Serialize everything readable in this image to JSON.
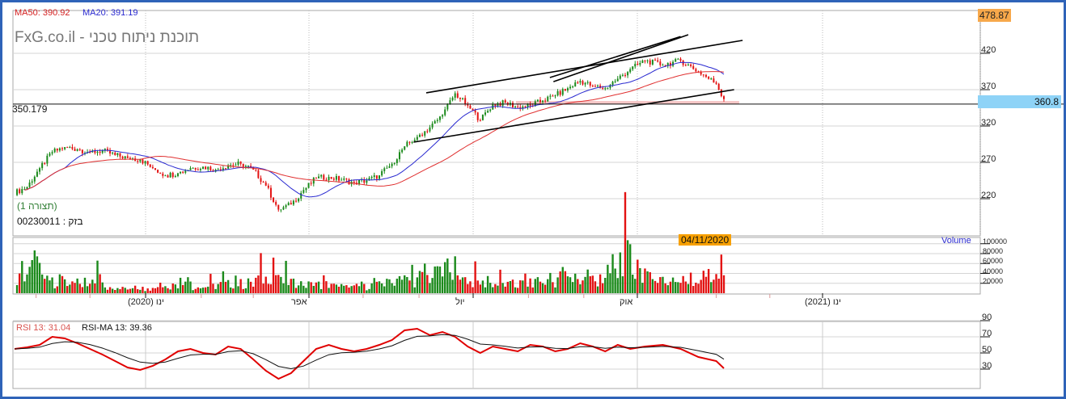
{
  "header": {
    "ma50_label": "MA50: 390.92",
    "ma20_label": "MA20: 391.19",
    "title": "תוכנת ניתוח טכני - FxG.co.il",
    "view_label": "(תצורה 1)",
    "symbol_label": "בזק : 00230011",
    "hline_label": "350.179",
    "top_price_badge": "478.87",
    "cursor_price_badge": "360.8",
    "date_badge": "04/11/2020",
    "volume_label": "Volume",
    "rsi_label": "RSI 13: 31.04",
    "rsi_ma_label": "RSI-MA 13: 39.36"
  },
  "colors": {
    "up": "#1b8a1b",
    "down": "#e31212",
    "ma20": "#2a2ad0",
    "ma50": "#e03030",
    "rsi": "#e00000",
    "rsi_ma": "#111111",
    "badge_orange": "#f7a84a",
    "badge_blue": "#8ed3f7",
    "frame": "#2f63b8"
  },
  "chart_data": [
    {
      "type": "candlestick",
      "panel": "price",
      "yticks": [
        420,
        370,
        320,
        270,
        220
      ],
      "ylim": [
        180,
        478.87
      ],
      "xticks": [
        {
          "date": "2020-01-01",
          "label": "ינו (2020)"
        },
        {
          "date": "2020-04-01",
          "label": "אפר"
        },
        {
          "date": "2020-07-01",
          "label": "יול"
        },
        {
          "date": "2020-10-01",
          "label": "אוק"
        },
        {
          "date": "2021-01-01",
          "label": "ינו (2021)"
        }
      ],
      "dates": [
        "2019-10-20",
        "2019-10-27",
        "2019-11-03",
        "2019-11-10",
        "2019-11-17",
        "2019-11-24",
        "2019-12-01",
        "2019-12-08",
        "2019-12-15",
        "2019-12-22",
        "2019-12-29",
        "2020-01-05",
        "2020-01-12",
        "2020-01-19",
        "2020-01-26",
        "2020-02-02",
        "2020-02-09",
        "2020-02-16",
        "2020-02-23",
        "2020-03-01",
        "2020-03-08",
        "2020-03-15",
        "2020-03-22",
        "2020-03-29",
        "2020-04-05",
        "2020-04-12",
        "2020-04-19",
        "2020-04-26",
        "2020-05-03",
        "2020-05-10",
        "2020-05-17",
        "2020-05-24",
        "2020-05-31",
        "2020-06-07",
        "2020-06-14",
        "2020-06-21",
        "2020-06-28",
        "2020-07-05",
        "2020-07-12",
        "2020-07-19",
        "2020-07-26",
        "2020-08-02",
        "2020-08-09",
        "2020-08-16",
        "2020-08-23",
        "2020-08-30",
        "2020-09-06",
        "2020-09-13",
        "2020-09-20",
        "2020-09-27",
        "2020-10-04",
        "2020-10-11",
        "2020-10-18",
        "2020-10-25",
        "2020-11-01",
        "2020-11-04"
      ],
      "close": [
        228,
        236,
        262,
        284,
        291,
        288,
        284,
        286,
        280,
        276,
        274,
        262,
        252,
        255,
        262,
        264,
        260,
        266,
        268,
        260,
        238,
        205,
        212,
        232,
        248,
        250,
        246,
        242,
        245,
        252,
        268,
        292,
        305,
        318,
        335,
        365,
        348,
        328,
        350,
        352,
        346,
        348,
        355,
        362,
        372,
        382,
        375,
        372,
        385,
        398,
        410,
        404,
        410,
        395,
        378,
        357
      ],
      "volume": [
        15000,
        40000,
        90000,
        50000,
        35000,
        30000,
        20000,
        45000,
        18000,
        12000,
        20000,
        15000,
        22000,
        25000,
        40000,
        18000,
        22000,
        28000,
        30000,
        25000,
        45000,
        60000,
        35000,
        30000,
        25000,
        28000,
        22000,
        18000,
        20000,
        25000,
        30000,
        45000,
        40000,
        50000,
        55000,
        80000,
        45000,
        35000,
        30000,
        28000,
        25000,
        30000,
        32000,
        35000,
        50000,
        40000,
        45000,
        38000,
        60000,
        110000,
        70000,
        45000,
        35000,
        40000,
        50000,
        45000
      ],
      "series": [
        {
          "name": "MA20"
        },
        {
          "name": "MA50"
        }
      ],
      "horizontal_line": 350.179,
      "support_zone": [
        350.2,
        354.4
      ],
      "trendlines": [
        {
          "from": [
            "2020-06-05",
            365.6
          ],
          "to": [
            "2020-11-15",
            437.8
          ]
        },
        {
          "from": [
            "2020-05-29",
            297.8
          ],
          "to": [
            "2020-11-10",
            370.0
          ]
        },
        {
          "from": [
            "2020-08-15",
            381.0
          ],
          "to": [
            "2020-10-21",
            445.6
          ]
        },
        {
          "from": [
            "2020-08-13",
            386.7
          ],
          "to": [
            "2020-10-18",
            443.0
          ]
        }
      ]
    },
    {
      "type": "bar",
      "panel": "volume",
      "ylabel": "Volume",
      "yticks": [
        100000,
        80000,
        60000,
        40000,
        20000
      ]
    },
    {
      "type": "line",
      "panel": "rsi",
      "yticks": [
        90,
        70,
        50,
        30
      ],
      "ylim": [
        10,
        90
      ],
      "series": [
        {
          "name": "RSI 13",
          "values": [
            55,
            57,
            60,
            70,
            68,
            62,
            55,
            48,
            40,
            32,
            29,
            34,
            42,
            52,
            55,
            50,
            48,
            58,
            55,
            42,
            28,
            18,
            25,
            40,
            55,
            60,
            55,
            52,
            55,
            60,
            66,
            78,
            80,
            72,
            76,
            70,
            58,
            50,
            58,
            55,
            52,
            60,
            58,
            52,
            55,
            62,
            58,
            52,
            60,
            55,
            58,
            60,
            55,
            45,
            40,
            31.04
          ]
        }
      ]
    }
  ]
}
